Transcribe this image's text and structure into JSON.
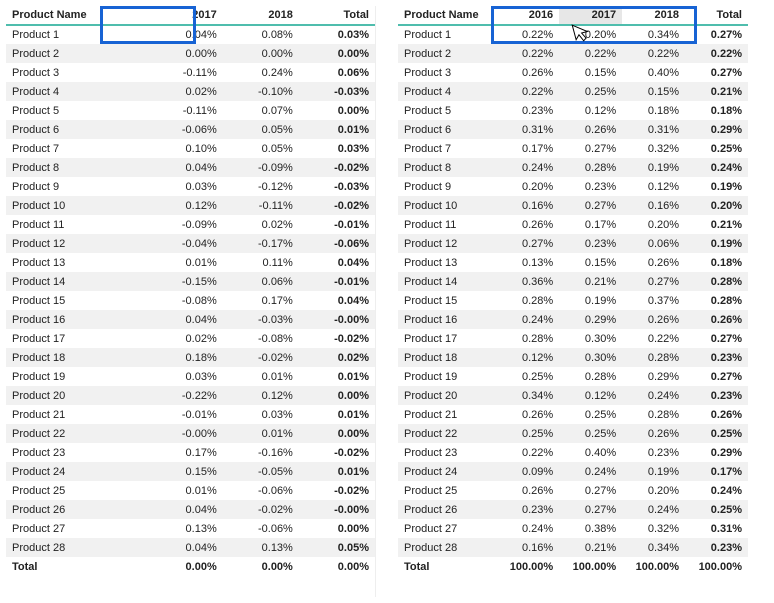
{
  "left": {
    "headers": {
      "name": "Product Name",
      "y1": "2017",
      "y2": "2018",
      "total": "Total"
    },
    "rows": [
      {
        "name": "Product 1",
        "y1": "0.04%",
        "y2": "0.08%",
        "total": "0.03%"
      },
      {
        "name": "Product 2",
        "y1": "0.00%",
        "y2": "0.00%",
        "total": "0.00%"
      },
      {
        "name": "Product 3",
        "y1": "-0.11%",
        "y2": "0.24%",
        "total": "0.06%"
      },
      {
        "name": "Product 4",
        "y1": "0.02%",
        "y2": "-0.10%",
        "total": "-0.03%"
      },
      {
        "name": "Product 5",
        "y1": "-0.11%",
        "y2": "0.07%",
        "total": "0.00%"
      },
      {
        "name": "Product 6",
        "y1": "-0.06%",
        "y2": "0.05%",
        "total": "0.01%"
      },
      {
        "name": "Product 7",
        "y1": "0.10%",
        "y2": "0.05%",
        "total": "0.03%"
      },
      {
        "name": "Product 8",
        "y1": "0.04%",
        "y2": "-0.09%",
        "total": "-0.02%"
      },
      {
        "name": "Product 9",
        "y1": "0.03%",
        "y2": "-0.12%",
        "total": "-0.03%"
      },
      {
        "name": "Product 10",
        "y1": "0.12%",
        "y2": "-0.11%",
        "total": "-0.02%"
      },
      {
        "name": "Product 11",
        "y1": "-0.09%",
        "y2": "0.02%",
        "total": "-0.01%"
      },
      {
        "name": "Product 12",
        "y1": "-0.04%",
        "y2": "-0.17%",
        "total": "-0.06%"
      },
      {
        "name": "Product 13",
        "y1": "0.01%",
        "y2": "0.11%",
        "total": "0.04%"
      },
      {
        "name": "Product 14",
        "y1": "-0.15%",
        "y2": "0.06%",
        "total": "-0.01%"
      },
      {
        "name": "Product 15",
        "y1": "-0.08%",
        "y2": "0.17%",
        "total": "0.04%"
      },
      {
        "name": "Product 16",
        "y1": "0.04%",
        "y2": "-0.03%",
        "total": "-0.00%"
      },
      {
        "name": "Product 17",
        "y1": "0.02%",
        "y2": "-0.08%",
        "total": "-0.02%"
      },
      {
        "name": "Product 18",
        "y1": "0.18%",
        "y2": "-0.02%",
        "total": "0.02%"
      },
      {
        "name": "Product 19",
        "y1": "0.03%",
        "y2": "0.01%",
        "total": "0.01%"
      },
      {
        "name": "Product 20",
        "y1": "-0.22%",
        "y2": "0.12%",
        "total": "0.00%"
      },
      {
        "name": "Product 21",
        "y1": "-0.01%",
        "y2": "0.03%",
        "total": "0.01%"
      },
      {
        "name": "Product 22",
        "y1": "-0.00%",
        "y2": "0.01%",
        "total": "0.00%"
      },
      {
        "name": "Product 23",
        "y1": "0.17%",
        "y2": "-0.16%",
        "total": "-0.02%"
      },
      {
        "name": "Product 24",
        "y1": "0.15%",
        "y2": "-0.05%",
        "total": "0.01%"
      },
      {
        "name": "Product 25",
        "y1": "0.01%",
        "y2": "-0.06%",
        "total": "-0.02%"
      },
      {
        "name": "Product 26",
        "y1": "0.04%",
        "y2": "-0.02%",
        "total": "-0.00%"
      },
      {
        "name": "Product 27",
        "y1": "0.13%",
        "y2": "-0.06%",
        "total": "0.00%"
      },
      {
        "name": "Product 28",
        "y1": "0.04%",
        "y2": "0.13%",
        "total": "0.05%"
      }
    ],
    "footer": {
      "name": "Total",
      "y1": "0.00%",
      "y2": "0.00%",
      "total": "0.00%"
    }
  },
  "right": {
    "headers": {
      "name": "Product Name",
      "y1": "2016",
      "y2": "2017",
      "y3": "2018",
      "total": "Total"
    },
    "rows": [
      {
        "name": "Product 1",
        "y1": "0.22%",
        "y2": "0.20%",
        "y3": "0.34%",
        "total": "0.27%"
      },
      {
        "name": "Product 2",
        "y1": "0.22%",
        "y2": "0.22%",
        "y3": "0.22%",
        "total": "0.22%"
      },
      {
        "name": "Product 3",
        "y1": "0.26%",
        "y2": "0.15%",
        "y3": "0.40%",
        "total": "0.27%"
      },
      {
        "name": "Product 4",
        "y1": "0.22%",
        "y2": "0.25%",
        "y3": "0.15%",
        "total": "0.21%"
      },
      {
        "name": "Product 5",
        "y1": "0.23%",
        "y2": "0.12%",
        "y3": "0.18%",
        "total": "0.18%"
      },
      {
        "name": "Product 6",
        "y1": "0.31%",
        "y2": "0.26%",
        "y3": "0.31%",
        "total": "0.29%"
      },
      {
        "name": "Product 7",
        "y1": "0.17%",
        "y2": "0.27%",
        "y3": "0.32%",
        "total": "0.25%"
      },
      {
        "name": "Product 8",
        "y1": "0.24%",
        "y2": "0.28%",
        "y3": "0.19%",
        "total": "0.24%"
      },
      {
        "name": "Product 9",
        "y1": "0.20%",
        "y2": "0.23%",
        "y3": "0.12%",
        "total": "0.19%"
      },
      {
        "name": "Product 10",
        "y1": "0.16%",
        "y2": "0.27%",
        "y3": "0.16%",
        "total": "0.20%"
      },
      {
        "name": "Product 11",
        "y1": "0.26%",
        "y2": "0.17%",
        "y3": "0.20%",
        "total": "0.21%"
      },
      {
        "name": "Product 12",
        "y1": "0.27%",
        "y2": "0.23%",
        "y3": "0.06%",
        "total": "0.19%"
      },
      {
        "name": "Product 13",
        "y1": "0.13%",
        "y2": "0.15%",
        "y3": "0.26%",
        "total": "0.18%"
      },
      {
        "name": "Product 14",
        "y1": "0.36%",
        "y2": "0.21%",
        "y3": "0.27%",
        "total": "0.28%"
      },
      {
        "name": "Product 15",
        "y1": "0.28%",
        "y2": "0.19%",
        "y3": "0.37%",
        "total": "0.28%"
      },
      {
        "name": "Product 16",
        "y1": "0.24%",
        "y2": "0.29%",
        "y3": "0.26%",
        "total": "0.26%"
      },
      {
        "name": "Product 17",
        "y1": "0.28%",
        "y2": "0.30%",
        "y3": "0.22%",
        "total": "0.27%"
      },
      {
        "name": "Product 18",
        "y1": "0.12%",
        "y2": "0.30%",
        "y3": "0.28%",
        "total": "0.23%"
      },
      {
        "name": "Product 19",
        "y1": "0.25%",
        "y2": "0.28%",
        "y3": "0.29%",
        "total": "0.27%"
      },
      {
        "name": "Product 20",
        "y1": "0.34%",
        "y2": "0.12%",
        "y3": "0.24%",
        "total": "0.23%"
      },
      {
        "name": "Product 21",
        "y1": "0.26%",
        "y2": "0.25%",
        "y3": "0.28%",
        "total": "0.26%"
      },
      {
        "name": "Product 22",
        "y1": "0.25%",
        "y2": "0.25%",
        "y3": "0.26%",
        "total": "0.25%"
      },
      {
        "name": "Product 23",
        "y1": "0.22%",
        "y2": "0.40%",
        "y3": "0.23%",
        "total": "0.29%"
      },
      {
        "name": "Product 24",
        "y1": "0.09%",
        "y2": "0.24%",
        "y3": "0.19%",
        "total": "0.17%"
      },
      {
        "name": "Product 25",
        "y1": "0.26%",
        "y2": "0.27%",
        "y3": "0.20%",
        "total": "0.24%"
      },
      {
        "name": "Product 26",
        "y1": "0.23%",
        "y2": "0.27%",
        "y3": "0.24%",
        "total": "0.25%"
      },
      {
        "name": "Product 27",
        "y1": "0.24%",
        "y2": "0.38%",
        "y3": "0.32%",
        "total": "0.31%"
      },
      {
        "name": "Product 28",
        "y1": "0.16%",
        "y2": "0.21%",
        "y3": "0.34%",
        "total": "0.23%"
      }
    ],
    "footer": {
      "name": "Total",
      "y1": "100.00%",
      "y2": "100.00%",
      "y3": "100.00%",
      "total": "100.00%"
    }
  }
}
